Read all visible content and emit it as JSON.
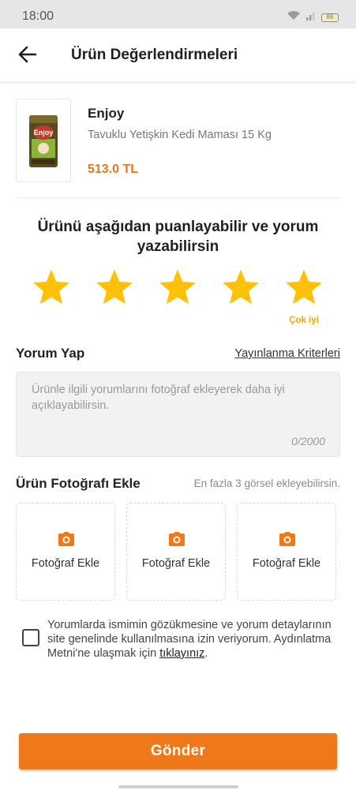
{
  "status_bar": {
    "time": "18:00",
    "battery": "86",
    "icons": [
      "wifi-icon",
      "signal-icon",
      "battery-icon"
    ]
  },
  "header": {
    "title": "Ürün Değerlendirmeleri",
    "back_icon": "arrow-left-icon"
  },
  "product": {
    "brand": "Enjoy",
    "name": "Tavuklu Yetişkin Kedi Maması 15 Kg",
    "price": "513.0 TL",
    "package_logo": "Enjoy"
  },
  "rating": {
    "prompt": "Ürünü aşağıdan puanlayabilir ve yorum yazabilirsin",
    "selected": 5,
    "max": 5,
    "caption": "Çok iyi",
    "star_color": "#ffc107"
  },
  "comment": {
    "title": "Yorum Yap",
    "criteria_link": "Yayınlanma Kriterleri",
    "placeholder": "Ürünle ilgili yorumlarını fotoğraf ekleyerek daha iyi açıklayabilirsin.",
    "counter": "0/2000"
  },
  "photos": {
    "title": "Ürün Fotoğrafı Ekle",
    "hint": "En fazla 3 görsel ekleyebilirsin.",
    "slots": [
      {
        "label": "Fotoğraf Ekle",
        "icon": "camera-icon"
      },
      {
        "label": "Fotoğraf Ekle",
        "icon": "camera-icon"
      },
      {
        "label": "Fotoğraf Ekle",
        "icon": "camera-icon"
      }
    ]
  },
  "consent": {
    "text": "Yorumlarda ismimin gözükmesine ve yorum detaylarının site genelinde kullanılmasına izin veriyorum. Aydınlatma Metni'ne ulaşmak için",
    "link": "tıklayınız",
    "suffix": ".",
    "checked": false
  },
  "submit": {
    "label": "Gönder"
  },
  "colors": {
    "accent": "#f07818",
    "price": "#e07a22",
    "star": "#ffc107",
    "caption": "#f0a800"
  }
}
